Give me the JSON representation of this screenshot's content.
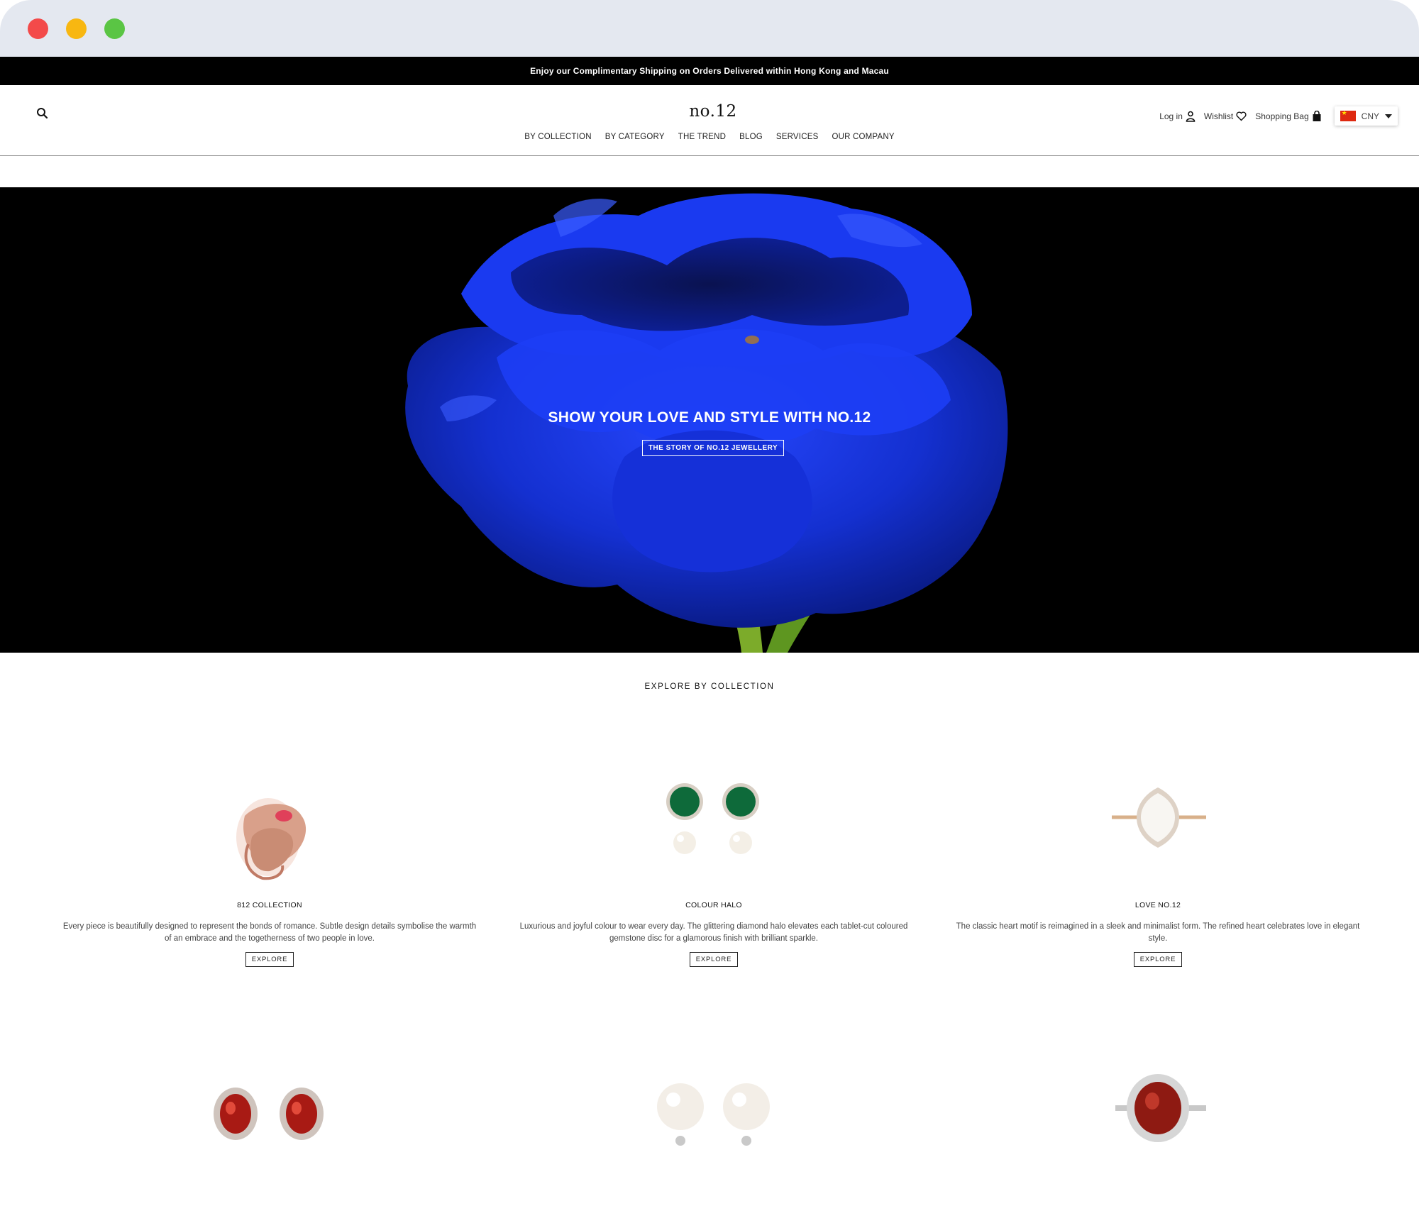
{
  "announcement": "Enjoy our Complimentary Shipping on Orders Delivered within Hong Kong and Macau",
  "header": {
    "logo": "no.12",
    "nav": [
      "BY COLLECTION",
      "BY CATEGORY",
      "THE TREND",
      "BLOG",
      "SERVICES",
      "OUR COMPANY"
    ],
    "login_label": "Log in",
    "wishlist_label": "Wishlist",
    "bag_label": "Shopping Bag",
    "currency": "CNY"
  },
  "hero": {
    "title": "SHOW YOUR LOVE AND STYLE WITH NO.12",
    "button": "THE STORY OF NO.12 JEWELLERY"
  },
  "collections": {
    "title": "EXPLORE BY COLLECTION",
    "explore_label": "EXPLORE",
    "items": [
      {
        "name": "812 COLLECTION",
        "desc": "Every piece is beautifully designed to represent the bonds of romance. Subtle design details symbolise the warmth of an embrace and the togetherness of two people in love."
      },
      {
        "name": "COLOUR HALO",
        "desc": "Luxurious and joyful colour to wear every day. The glittering diamond halo elevates each tablet-cut coloured gemstone disc for a glamorous finish with brilliant sparkle."
      },
      {
        "name": "LOVE NO.12",
        "desc": "The classic heart motif is reimagined in a sleek and minimalist form. The refined heart celebrates love in elegant style."
      }
    ]
  },
  "colors": {
    "announcement_bg": "#000000",
    "hero_bg": "#000000",
    "flower_blue": "#1530d8",
    "chrome_bg": "#e4e8f0"
  }
}
